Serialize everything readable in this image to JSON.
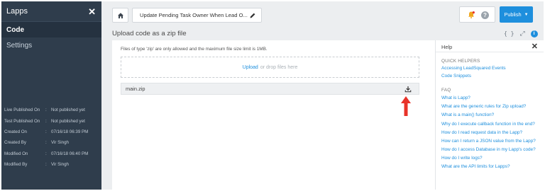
{
  "sidebar": {
    "title": "Lapps",
    "nav": [
      {
        "label": "Code",
        "active": true
      },
      {
        "label": "Settings",
        "active": false
      }
    ],
    "meta": [
      {
        "label": "Live Published On",
        "value": "Not published yet"
      },
      {
        "label": "Test Published On",
        "value": "Not published yet"
      },
      {
        "label": "Created On",
        "value": "07/16/18 06:39 PM"
      },
      {
        "label": "Created By",
        "value": "Vir Singh"
      },
      {
        "label": "Modified On",
        "value": "07/16/18 06:40 PM"
      },
      {
        "label": "Modified By",
        "value": "Vir Singh"
      }
    ]
  },
  "topbar": {
    "task_name": "Update Pending Task Owner When Lead O...",
    "publish_label": "Publish",
    "help_glyph": "?"
  },
  "main": {
    "title": "Upload code as a zip file",
    "code_glyph": "{ }",
    "info_glyph": "i",
    "upload_hint": "Files of type 'zip' are only allowed and the maximum file size limit is 1MB.",
    "upload_link": "Upload",
    "drop_text": "or drop files here",
    "file_name": "main.zip"
  },
  "help": {
    "title": "Help",
    "quick_helpers_heading": "QUICK HELPERS",
    "quick_helpers": [
      "Accessing LeadSquared Events",
      "Code Snippets"
    ],
    "faq_heading": "FAQ",
    "faq": [
      "What is Lapp?",
      "What are the generic rules for Zip upload?",
      "What is a main() function?",
      "Why do I execute callback function in the end?",
      "How do I read request data in the Lapp?",
      "How can I return a JSON value from the Lapp?",
      "How do I access Database in my Lapp's code?",
      "How do I write logs?",
      "What are the API limits for Lapps?"
    ]
  },
  "icons": {
    "close": "close-icon",
    "home": "home-icon",
    "edit": "pencil-icon",
    "bell": "bell-icon",
    "download": "download-icon",
    "annotation": "red-arrow-icon"
  },
  "colors": {
    "sidebar_bg": "#2f3d4c",
    "accent": "#1e8fdd",
    "annotation": "#e8332a"
  }
}
